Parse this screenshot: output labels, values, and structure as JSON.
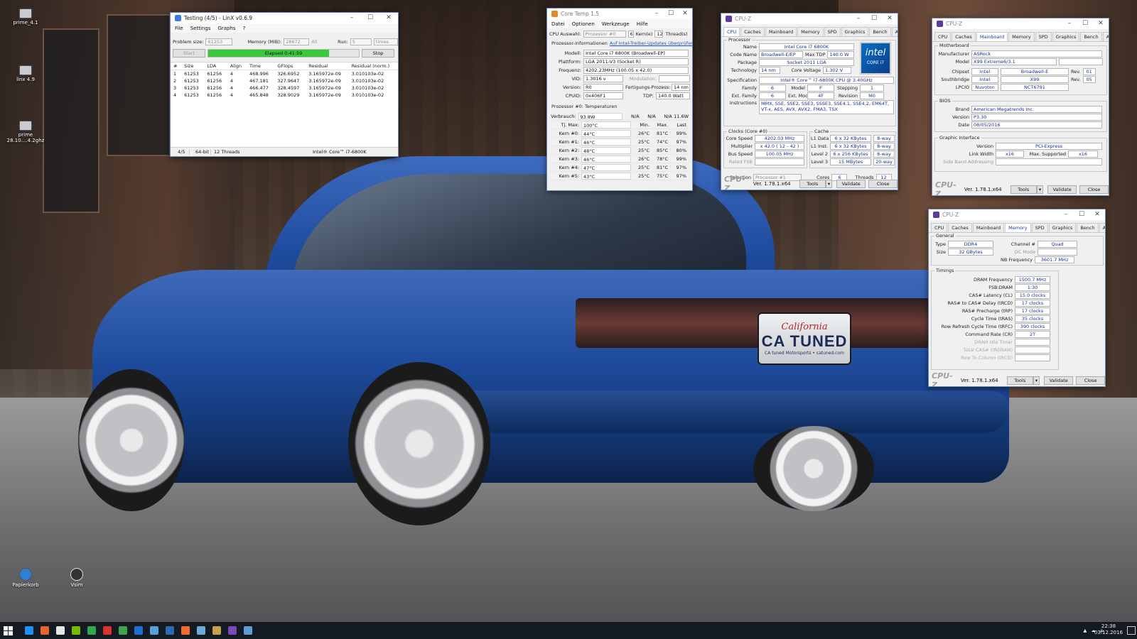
{
  "desktop": {
    "icons": [
      {
        "label": "prime_4.1"
      },
      {
        "label": "linx 4.9"
      },
      {
        "label": "prime 28.10....4.2ghz"
      },
      {
        "label": "Papierkorb"
      },
      {
        "label": "Vsim"
      }
    ],
    "plate": {
      "state": "California",
      "number": "CA TUNED",
      "sub": "CA tuned Motorsports • catuned.com"
    }
  },
  "linx": {
    "title": "Testing (4/5) - LinX v0.6.9",
    "menu": [
      "File",
      "Settings",
      "Graphs",
      "?"
    ],
    "problem_size_label": "Problem size:",
    "problem_size": "61253",
    "memory_label": "Memory (MiB):",
    "memory": "28672",
    "all_label": "All",
    "run_label": "Run:",
    "run": "5",
    "times_label": "times",
    "start": "Start",
    "elapsed": "Elapsed 0:41:59",
    "progress": 0.8,
    "stop": "Stop",
    "columns": [
      "#",
      "Size",
      "LDA",
      "Align",
      "Time",
      "GFlops",
      "Residual",
      "Residual (norm.)"
    ],
    "rows": [
      [
        "1",
        "61253",
        "61256",
        "4",
        "468.996",
        "326.6952",
        "3.165972e-09",
        "3.010103e-02"
      ],
      [
        "2",
        "61253",
        "61256",
        "4",
        "467.181",
        "327.9647",
        "3.165972e-09",
        "3.010103e-02"
      ],
      [
        "3",
        "61253",
        "61256",
        "4",
        "466.477",
        "328.4597",
        "3.165972e-09",
        "3.010103e-02"
      ],
      [
        "4",
        "61253",
        "61256",
        "4",
        "465.848",
        "328.9029",
        "3.165972e-09",
        "3.010103e-02"
      ]
    ],
    "status": [
      "4/5",
      "64-bit",
      "12 Threads",
      "Intel® Core™ i7-6800K"
    ]
  },
  "coretemp": {
    "title": "Core Temp 1.5",
    "menu": [
      "Datei",
      "Optionen",
      "Werkzeuge",
      "Hilfe"
    ],
    "cpu_select_label": "CPU Auswahl:",
    "cpu_select": "Prozessor #0",
    "cores": "6",
    "cores_label": "Kern(e)",
    "threads": "12",
    "threads_label": "Thread(s)",
    "info_label": "Prozessor-Informationen",
    "info_link": "Auf Intel-Treiber-Updates überprüfen",
    "model_label": "Modell:",
    "model": "Intel Core i7 6800K (Broadwell-EP)",
    "platform_label": "Plattform:",
    "platform": "LGA 2011-V3 (Socket R)",
    "freq_label": "Frequenz:",
    "freq": "4202.23MHz (100.05 x 42.0)",
    "vid_label": "VID:",
    "vid": "1.3016 v",
    "modulation_label": "Modulation:",
    "version_label": "Version:",
    "version": "R0",
    "process_label": "Fertigungs-Prozess:",
    "process": "14 nm",
    "cpuid_label": "CPUID:",
    "cpuid": "0x406F1",
    "tdp_label": "TDP:",
    "tdp": "140.0 Watt",
    "temps_label": "Prozessor #0: Temperaturen",
    "power_label": "Verbrauch:",
    "power": "93.8W",
    "na": "N/A",
    "power_last": "11.6W",
    "tjmax_label": "Tj. Max:",
    "tjmax": "100°C",
    "min_label": "Min.",
    "max_label": "Max.",
    "last_label": "Last",
    "cores_temps": [
      {
        "name": "Kern #0:",
        "temp": "44°C",
        "min": "26°C",
        "max": "81°C",
        "load": "99%"
      },
      {
        "name": "Kern #1:",
        "temp": "46°C",
        "min": "25°C",
        "max": "74°C",
        "load": "97%"
      },
      {
        "name": "Kern #2:",
        "temp": "48°C",
        "min": "25°C",
        "max": "85°C",
        "load": "80%"
      },
      {
        "name": "Kern #3:",
        "temp": "46°C",
        "min": "26°C",
        "max": "78°C",
        "load": "99%"
      },
      {
        "name": "Kern #4:",
        "temp": "47°C",
        "min": "25°C",
        "max": "81°C",
        "load": "97%"
      },
      {
        "name": "Kern #5:",
        "temp": "43°C",
        "min": "25°C",
        "max": "75°C",
        "load": "97%"
      }
    ]
  },
  "cpuz_cpu": {
    "title": "CPU-Z",
    "tabs": [
      "CPU",
      "Caches",
      "Mainboard",
      "Memory",
      "SPD",
      "Graphics",
      "Bench",
      "About"
    ],
    "processor_group": "Processor",
    "name_label": "Name",
    "name": "Intel Core i7 6800K",
    "codename_label": "Code Name",
    "codename": "Broadwell-E/EP",
    "maxtdp_label": "Max TDP",
    "maxtdp": "140.0 W",
    "package_label": "Package",
    "package": "Socket 2011 LGA",
    "tech_label": "Technology",
    "tech": "14 nm",
    "corev_label": "Core Voltage",
    "corev": "1.302 V",
    "spec_label": "Specification",
    "spec": "Intel® Core™ i7-6800K CPU @ 3.40GHz",
    "family_label": "Family",
    "family": "6",
    "model_label": "Model",
    "model": "F",
    "stepping_label": "Stepping",
    "stepping": "1",
    "extfamily_label": "Ext. Family",
    "extfamily": "6",
    "extmodel_label": "Ext. Model",
    "extmodel": "4F",
    "revision_label": "Revision",
    "revision": "M0",
    "instr_label": "Instructions",
    "instr": "MMX, SSE, SSE2, SSE3, SSSE3, SSE4.1, SSE4.2, EM64T, VT-x, AES, AVX, AVX2, FMA3, TSX",
    "clocks_group": "Clocks (Core #0)",
    "corespeed_label": "Core Speed",
    "corespeed": "4202.03 MHz",
    "mult_label": "Multiplier",
    "mult": "x 42.0 ( 12 - 42 )",
    "bus_label": "Bus Speed",
    "bus": "100.05 MHz",
    "ratedfsb_label": "Rated FSB",
    "cache_group": "Cache",
    "l1d_label": "L1 Data",
    "l1d": "6 x 32 KBytes",
    "l1d_way": "8-way",
    "l1i_label": "L1 Inst.",
    "l1i": "6 x 32 KBytes",
    "l1i_way": "8-way",
    "l2_label": "Level 2",
    "l2": "6 x 256 KBytes",
    "l2_way": "8-way",
    "l3_label": "Level 3",
    "l3": "15 MBytes",
    "l3_way": "20-way",
    "selection_label": "Selection",
    "selection": "Processor #1",
    "cores_label": "Cores",
    "cores": "6",
    "threads_label": "Threads",
    "threads": "12",
    "logo_brand": "intel",
    "logo_line": "CORE i7",
    "version": "Ver. 1.78.1.x64",
    "tools": "Tools",
    "validate": "Validate",
    "close": "Close"
  },
  "cpuz_mb": {
    "title": "CPU-Z",
    "tabs": [
      "CPU",
      "Caches",
      "Mainboard",
      "Memory",
      "SPD",
      "Graphics",
      "Bench",
      "About"
    ],
    "mb_group": "Motherboard",
    "manuf_label": "Manufacturer",
    "manuf": "ASRock",
    "model_label": "Model",
    "model": "X99 Extreme6/3.1",
    "chipset_label": "Chipset",
    "chipset_vendor": "Intel",
    "chipset": "Broadwell-E",
    "chipset_rev_label": "Rev.",
    "chipset_rev": "01",
    "south_label": "Southbridge",
    "south_vendor": "Intel",
    "south": "X99",
    "south_rev_label": "Rev.",
    "south_rev": "05",
    "lpcio_label": "LPCIO",
    "lpcio_vendor": "Nuvoton",
    "lpcio": "NCT6791",
    "bios_group": "BIOS",
    "brand_label": "Brand",
    "brand": "American Megatrends Inc.",
    "version_label": "Version",
    "bios_version": "P3.30",
    "date_label": "Date",
    "date": "08/05/2016",
    "gi_group": "Graphic Interface",
    "gi_version_label": "Version",
    "gi_version": "PCI-Express",
    "linkwidth_label": "Link Width",
    "linkwidth": "x16",
    "maxsup_label": "Max. Supported",
    "maxsup": "x16",
    "sideband_label": "Side Band Addressing",
    "version": "Ver. 1.78.1.x64",
    "tools": "Tools",
    "validate": "Validate",
    "close": "Close"
  },
  "cpuz_mem": {
    "title": "CPU-Z",
    "tabs": [
      "CPU",
      "Caches",
      "Mainboard",
      "Memory",
      "SPD",
      "Graphics",
      "Bench",
      "About"
    ],
    "general_group": "General",
    "type_label": "Type",
    "type": "DDR4",
    "channel_label": "Channel #",
    "channel": "Quad",
    "size_label": "Size",
    "size": "32 GBytes",
    "dcmode_label": "DC Mode",
    "nbfreq_label": "NB Frequency",
    "nbfreq": "3601.7 MHz",
    "timings_group": "Timings",
    "timings": [
      {
        "label": "DRAM Frequency",
        "value": "1500.7 MHz",
        "dim": false
      },
      {
        "label": "FSB:DRAM",
        "value": "1:30",
        "dim": false
      },
      {
        "label": "CAS# Latency (CL)",
        "value": "15.0 clocks",
        "dim": false
      },
      {
        "label": "RAS# to CAS# Delay (tRCD)",
        "value": "17 clocks",
        "dim": false
      },
      {
        "label": "RAS# Precharge (tRP)",
        "value": "17 clocks",
        "dim": false
      },
      {
        "label": "Cycle Time (tRAS)",
        "value": "35 clocks",
        "dim": false
      },
      {
        "label": "Row Refresh Cycle Time (tRFC)",
        "value": "390 clocks",
        "dim": false
      },
      {
        "label": "Command Rate (CR)",
        "value": "2T",
        "dim": false
      },
      {
        "label": "DRAM Idle Timer",
        "value": "",
        "dim": true
      },
      {
        "label": "Total CAS# (tRDRAM)",
        "value": "",
        "dim": true
      },
      {
        "label": "Row To Column (tRCD)",
        "value": "",
        "dim": true
      }
    ],
    "version": "Ver. 1.78.1.x64",
    "tools": "Tools",
    "validate": "Validate",
    "close": "Close"
  },
  "taskbar": {
    "time": "22:38",
    "date": "03.12.2016",
    "colors": [
      "#1e90ff",
      "#e8622c",
      "#e6e6e6",
      "#76b900",
      "#2fa84f",
      "#d9332f",
      "#3fa34d",
      "#1d6fd1",
      "#5aa0d8",
      "#2b6cb0",
      "#ef6c2e",
      "#6fa8dc",
      "#c9a04a",
      "#7b4bb8",
      "#5e9cd6"
    ]
  }
}
